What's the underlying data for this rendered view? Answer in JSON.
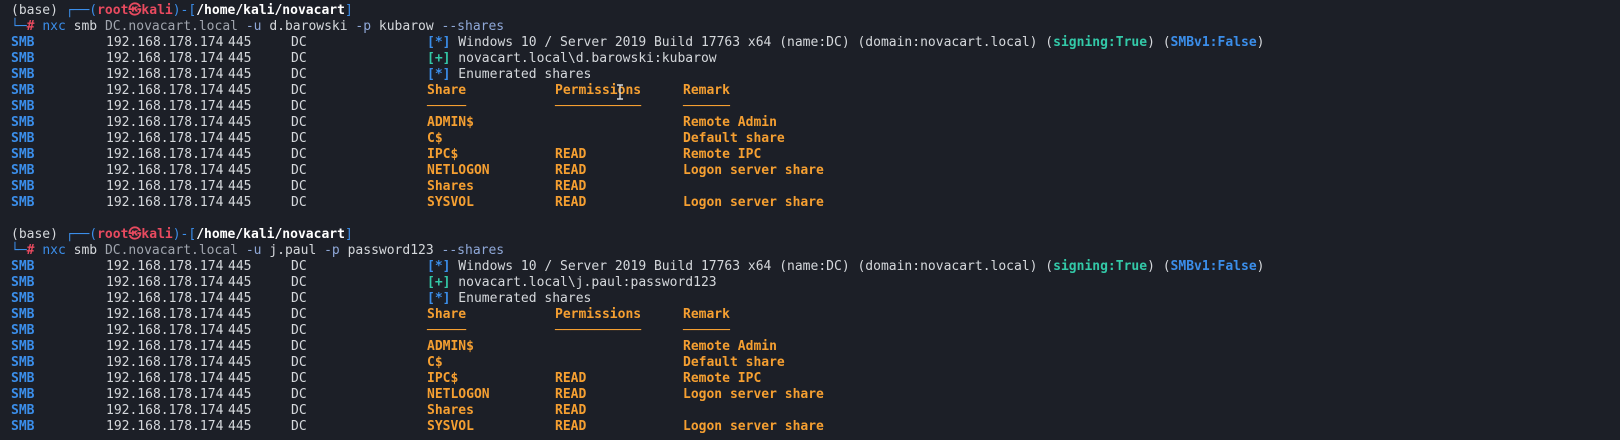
{
  "sessions": [
    {
      "prompt": {
        "env": "(base)",
        "user": "root",
        "at_symbol": "㉿",
        "host": "kali",
        "path": "/home/kali/novacart",
        "hash": "#"
      },
      "command": {
        "bin": "nxc",
        "proto": "smb",
        "target": "DC.novacart.local",
        "user_flag": "-u",
        "user": "d.barowski",
        "pass_flag": "-p",
        "password": "kubarow",
        "option": "--shares"
      },
      "rows": [
        {
          "proto": "SMB",
          "ip": "192.168.178.174",
          "port": "445",
          "host": "DC",
          "type": "info",
          "tag": "[*]",
          "text_pre": "Windows 10 / Server 2019 Build 17763 x64 (name:DC) (domain:novacart.local) (",
          "signing": "signing:True",
          "mid": ") (",
          "smbv1": "SMBv1:False",
          "text_post": ")"
        },
        {
          "proto": "SMB",
          "ip": "192.168.178.174",
          "port": "445",
          "host": "DC",
          "type": "ok",
          "tag": "[+]",
          "text": "novacart.local\\d.barowski:kubarow"
        },
        {
          "proto": "SMB",
          "ip": "192.168.178.174",
          "port": "445",
          "host": "DC",
          "type": "plain",
          "tag": "[*]",
          "text": "Enumerated shares"
        },
        {
          "proto": "SMB",
          "ip": "192.168.178.174",
          "port": "445",
          "host": "DC",
          "type": "header",
          "share": "Share",
          "perm": "Permissions",
          "remark": "Remark"
        },
        {
          "proto": "SMB",
          "ip": "192.168.178.174",
          "port": "445",
          "host": "DC",
          "type": "rule",
          "share": "─────",
          "perm": "───────────",
          "remark": "──────"
        },
        {
          "proto": "SMB",
          "ip": "192.168.178.174",
          "port": "445",
          "host": "DC",
          "type": "share",
          "share": "ADMIN$",
          "perm": "",
          "remark": "Remote Admin"
        },
        {
          "proto": "SMB",
          "ip": "192.168.178.174",
          "port": "445",
          "host": "DC",
          "type": "share",
          "share": "C$",
          "perm": "",
          "remark": "Default share"
        },
        {
          "proto": "SMB",
          "ip": "192.168.178.174",
          "port": "445",
          "host": "DC",
          "type": "share",
          "share": "IPC$",
          "perm": "READ",
          "remark": "Remote IPC"
        },
        {
          "proto": "SMB",
          "ip": "192.168.178.174",
          "port": "445",
          "host": "DC",
          "type": "share",
          "share": "NETLOGON",
          "perm": "READ",
          "remark": "Logon server share"
        },
        {
          "proto": "SMB",
          "ip": "192.168.178.174",
          "port": "445",
          "host": "DC",
          "type": "share",
          "share": "Shares",
          "perm": "READ",
          "remark": ""
        },
        {
          "proto": "SMB",
          "ip": "192.168.178.174",
          "port": "445",
          "host": "DC",
          "type": "share",
          "share": "SYSVOL",
          "perm": "READ",
          "remark": "Logon server share"
        }
      ]
    },
    {
      "prompt": {
        "env": "(base)",
        "user": "root",
        "at_symbol": "㉿",
        "host": "kali",
        "path": "/home/kali/novacart",
        "hash": "#"
      },
      "command": {
        "bin": "nxc",
        "proto": "smb",
        "target": "DC.novacart.local",
        "user_flag": "-u",
        "user": "j.paul",
        "pass_flag": "-p",
        "password": "password123",
        "option": "--shares"
      },
      "rows": [
        {
          "proto": "SMB",
          "ip": "192.168.178.174",
          "port": "445",
          "host": "DC",
          "type": "info",
          "tag": "[*]",
          "text_pre": "Windows 10 / Server 2019 Build 17763 x64 (name:DC) (domain:novacart.local) (",
          "signing": "signing:True",
          "mid": ") (",
          "smbv1": "SMBv1:False",
          "text_post": ")"
        },
        {
          "proto": "SMB",
          "ip": "192.168.178.174",
          "port": "445",
          "host": "DC",
          "type": "ok",
          "tag": "[+]",
          "text": "novacart.local\\j.paul:password123"
        },
        {
          "proto": "SMB",
          "ip": "192.168.178.174",
          "port": "445",
          "host": "DC",
          "type": "plain",
          "tag": "[*]",
          "text": "Enumerated shares"
        },
        {
          "proto": "SMB",
          "ip": "192.168.178.174",
          "port": "445",
          "host": "DC",
          "type": "header",
          "share": "Share",
          "perm": "Permissions",
          "remark": "Remark"
        },
        {
          "proto": "SMB",
          "ip": "192.168.178.174",
          "port": "445",
          "host": "DC",
          "type": "rule",
          "share": "─────",
          "perm": "───────────",
          "remark": "──────"
        },
        {
          "proto": "SMB",
          "ip": "192.168.178.174",
          "port": "445",
          "host": "DC",
          "type": "share",
          "share": "ADMIN$",
          "perm": "",
          "remark": "Remote Admin"
        },
        {
          "proto": "SMB",
          "ip": "192.168.178.174",
          "port": "445",
          "host": "DC",
          "type": "share",
          "share": "C$",
          "perm": "",
          "remark": "Default share"
        },
        {
          "proto": "SMB",
          "ip": "192.168.178.174",
          "port": "445",
          "host": "DC",
          "type": "share",
          "share": "IPC$",
          "perm": "READ",
          "remark": "Remote IPC"
        },
        {
          "proto": "SMB",
          "ip": "192.168.178.174",
          "port": "445",
          "host": "DC",
          "type": "share",
          "share": "NETLOGON",
          "perm": "READ",
          "remark": "Logon server share"
        },
        {
          "proto": "SMB",
          "ip": "192.168.178.174",
          "port": "445",
          "host": "DC",
          "type": "share",
          "share": "Shares",
          "perm": "READ",
          "remark": ""
        },
        {
          "proto": "SMB",
          "ip": "192.168.178.174",
          "port": "445",
          "host": "DC",
          "type": "share",
          "share": "SYSVOL",
          "perm": "READ",
          "remark": "Logon server share"
        }
      ]
    }
  ],
  "theme": {
    "background": "#1c1f27",
    "text": "#d5d8dc",
    "blue": "#3b8eea",
    "green": "#33c9a8",
    "orange": "#f59f31",
    "red": "#e84a5f"
  },
  "cursor_icon": "text-ibeam-cursor"
}
